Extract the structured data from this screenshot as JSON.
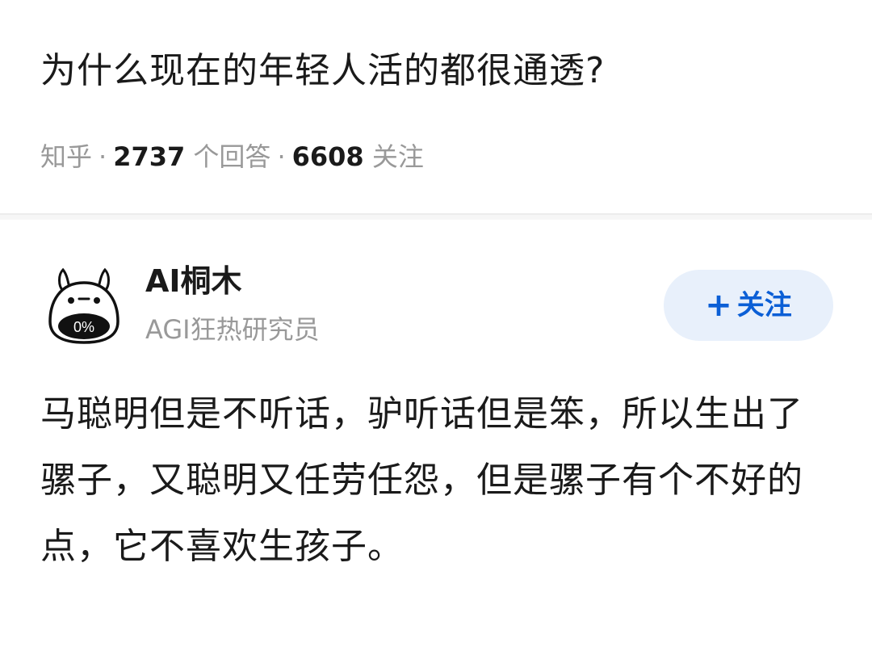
{
  "question": {
    "title": "为什么现在的年轻人活的都很通透?",
    "source": "知乎",
    "answer_count": "2737",
    "answer_label": "个回答",
    "follower_count": "6608",
    "follower_label": "关注",
    "separator": "·"
  },
  "answer": {
    "author": {
      "name": "AI桐木",
      "bio": "AGI狂热研究员",
      "avatar_badge": "0%",
      "avatar_icon": "totoro-avatar-icon"
    },
    "follow_button": {
      "plus": "+",
      "label": "关注"
    },
    "content": "马聪明但是不听话，驴听话但是笨，所以生出了骡子，又聪明又任劳任怨，但是骡子有个不好的点，它不喜欢生孩子。"
  },
  "colors": {
    "accent": "#0b5fd6",
    "follow_bg": "#e8f0fb",
    "meta_gray": "#999999",
    "text": "#1a1a1a"
  }
}
